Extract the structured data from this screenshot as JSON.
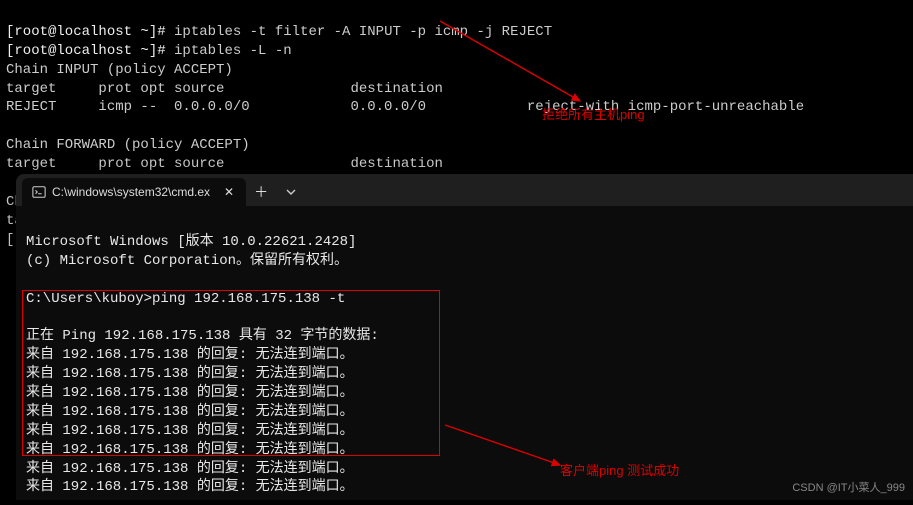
{
  "linux": {
    "prompt": "[root@localhost ~]# ",
    "cmd1": "iptables -t filter -A INPUT -p icmp -j REJECT",
    "cmd2": "iptables -L -n",
    "chain_input": "Chain INPUT (policy ACCEPT)",
    "header": "target     prot opt source               destination",
    "rule1": "REJECT     icmp --  0.0.0.0/0            0.0.0.0/0            reject-with icmp-port-unreachable",
    "chain_forward": "Chain FORWARD (policy ACCEPT)",
    "chain_output": "Chain OUTPUT (policy ACCEPT)",
    "cutoff1": "ta",
    "cutoff2": "["
  },
  "annotations": {
    "top": "拒绝所有主机ping",
    "bottom": "客户端ping 测试成功"
  },
  "cmd": {
    "tab_title": "C:\\windows\\system32\\cmd.ex",
    "line_version": "Microsoft Windows [版本 10.0.22621.2428]",
    "line_copyright": "(c) Microsoft Corporation。保留所有权利。",
    "prompt": "C:\\Users\\kuboy>",
    "ping_cmd": "ping 192.168.175.138 -t",
    "ping_header": "正在 Ping 192.168.175.138 具有 32 字节的数据:",
    "replies": [
      "来自 192.168.175.138 的回复: 无法连到端口。",
      "来自 192.168.175.138 的回复: 无法连到端口。",
      "来自 192.168.175.138 的回复: 无法连到端口。",
      "来自 192.168.175.138 的回复: 无法连到端口。",
      "来自 192.168.175.138 的回复: 无法连到端口。",
      "来自 192.168.175.138 的回复: 无法连到端口。",
      "来自 192.168.175.138 的回复: 无法连到端口。",
      "来自 192.168.175.138 的回复: 无法连到端口。"
    ]
  },
  "watermark": "CSDN @IT小菜人_999"
}
